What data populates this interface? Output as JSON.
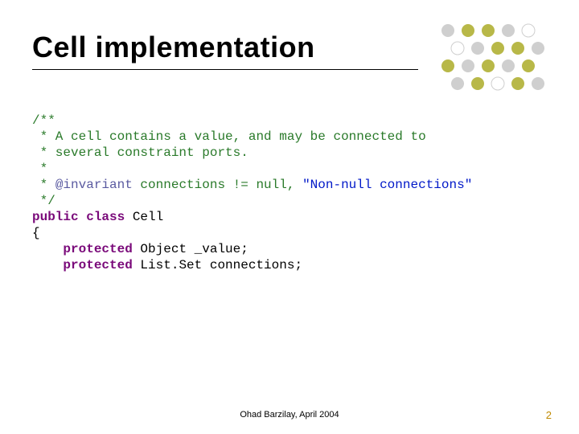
{
  "title": "Cell implementation",
  "code": {
    "l1": "/**",
    "l2": " * A cell contains a value, and may be connected to",
    "l3": " * several constraint ports.",
    "l4": " *",
    "l5_star": " * ",
    "l5_ann": "@invariant",
    "l5_mid": " connections != null, ",
    "l5_str": "\"Non-null connections\"",
    "l6": " */",
    "l7_kw": "public class",
    "l7_rest": " Cell",
    "l8": "{",
    "l9_indent": "    ",
    "l9_kw": "protected",
    "l9_rest": " Object _value;",
    "l10_indent": "    ",
    "l10_kw": "protected",
    "l10_rest": " List.Set connections;"
  },
  "footer": "Ohad Barzilay, April 2004",
  "page": "2",
  "dot_colors": {
    "olive": "#b8b848",
    "gray": "#cfcfcf",
    "white": "#ffffff"
  }
}
